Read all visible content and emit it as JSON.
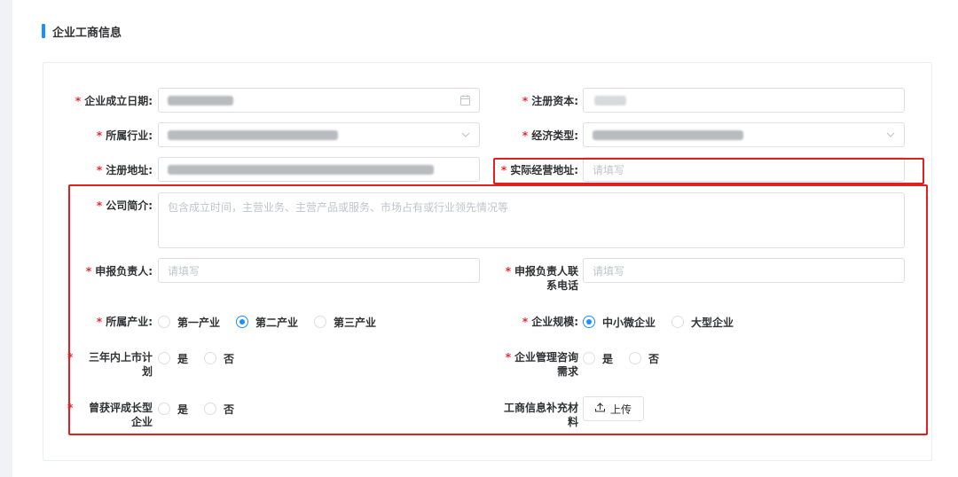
{
  "section": {
    "title": "企业工商信息"
  },
  "fields": {
    "establish_date": {
      "label": "企业成立日期:",
      "required": "*"
    },
    "reg_capital": {
      "label": "注册资本:",
      "required": "*"
    },
    "industry": {
      "label": "所属行业:",
      "required": "*"
    },
    "economy_type": {
      "label": "经济类型:",
      "required": "*"
    },
    "reg_address": {
      "label": "注册地址:",
      "required": "*"
    },
    "actual_address": {
      "label": "实际经营地址:",
      "required": "*",
      "placeholder": "请填写"
    },
    "company_intro": {
      "label": "公司简介:",
      "required": "*",
      "placeholder": "包含成立时间，主营业务、主营产品或服务、市场占有或行业领先情况等"
    },
    "applicant": {
      "label": "申报负责人:",
      "required": "*",
      "placeholder": "请填写"
    },
    "applicant_phone": {
      "label_1": "申报负责人联",
      "label_2": "系电话",
      "required": "*",
      "placeholder": "请填写"
    },
    "sector": {
      "label": "所属产业:",
      "required": "*",
      "options": [
        "第一产业",
        "第二产业",
        "第三产业"
      ],
      "selected": "第二产业"
    },
    "scale": {
      "label": "企业规模:",
      "required": "*",
      "options": [
        "中小微企业",
        "大型企业"
      ],
      "selected": "中小微企业"
    },
    "ipo_plan": {
      "label_1": "三年内上市计",
      "label_2": "划",
      "required": "*",
      "options": [
        "是",
        "否"
      ]
    },
    "consult_need": {
      "label_1": "企业管理咨询",
      "label_2": "需求",
      "required": "*",
      "options": [
        "是",
        "否"
      ]
    },
    "growth_award": {
      "label_1": "曾获评成长型",
      "label_2": "企业",
      "required": "*",
      "options": [
        "是",
        "否"
      ]
    },
    "supplement": {
      "label_1": "工商信息补充材",
      "label_2": "料",
      "button": "上传"
    }
  },
  "icons": {
    "calendar": "calendar-icon",
    "chevron": "chevron-down-icon",
    "upload": "upload-icon"
  },
  "colors": {
    "accent": "#1890ff",
    "required": "#f5222d",
    "highlight_box": "#e02020"
  }
}
